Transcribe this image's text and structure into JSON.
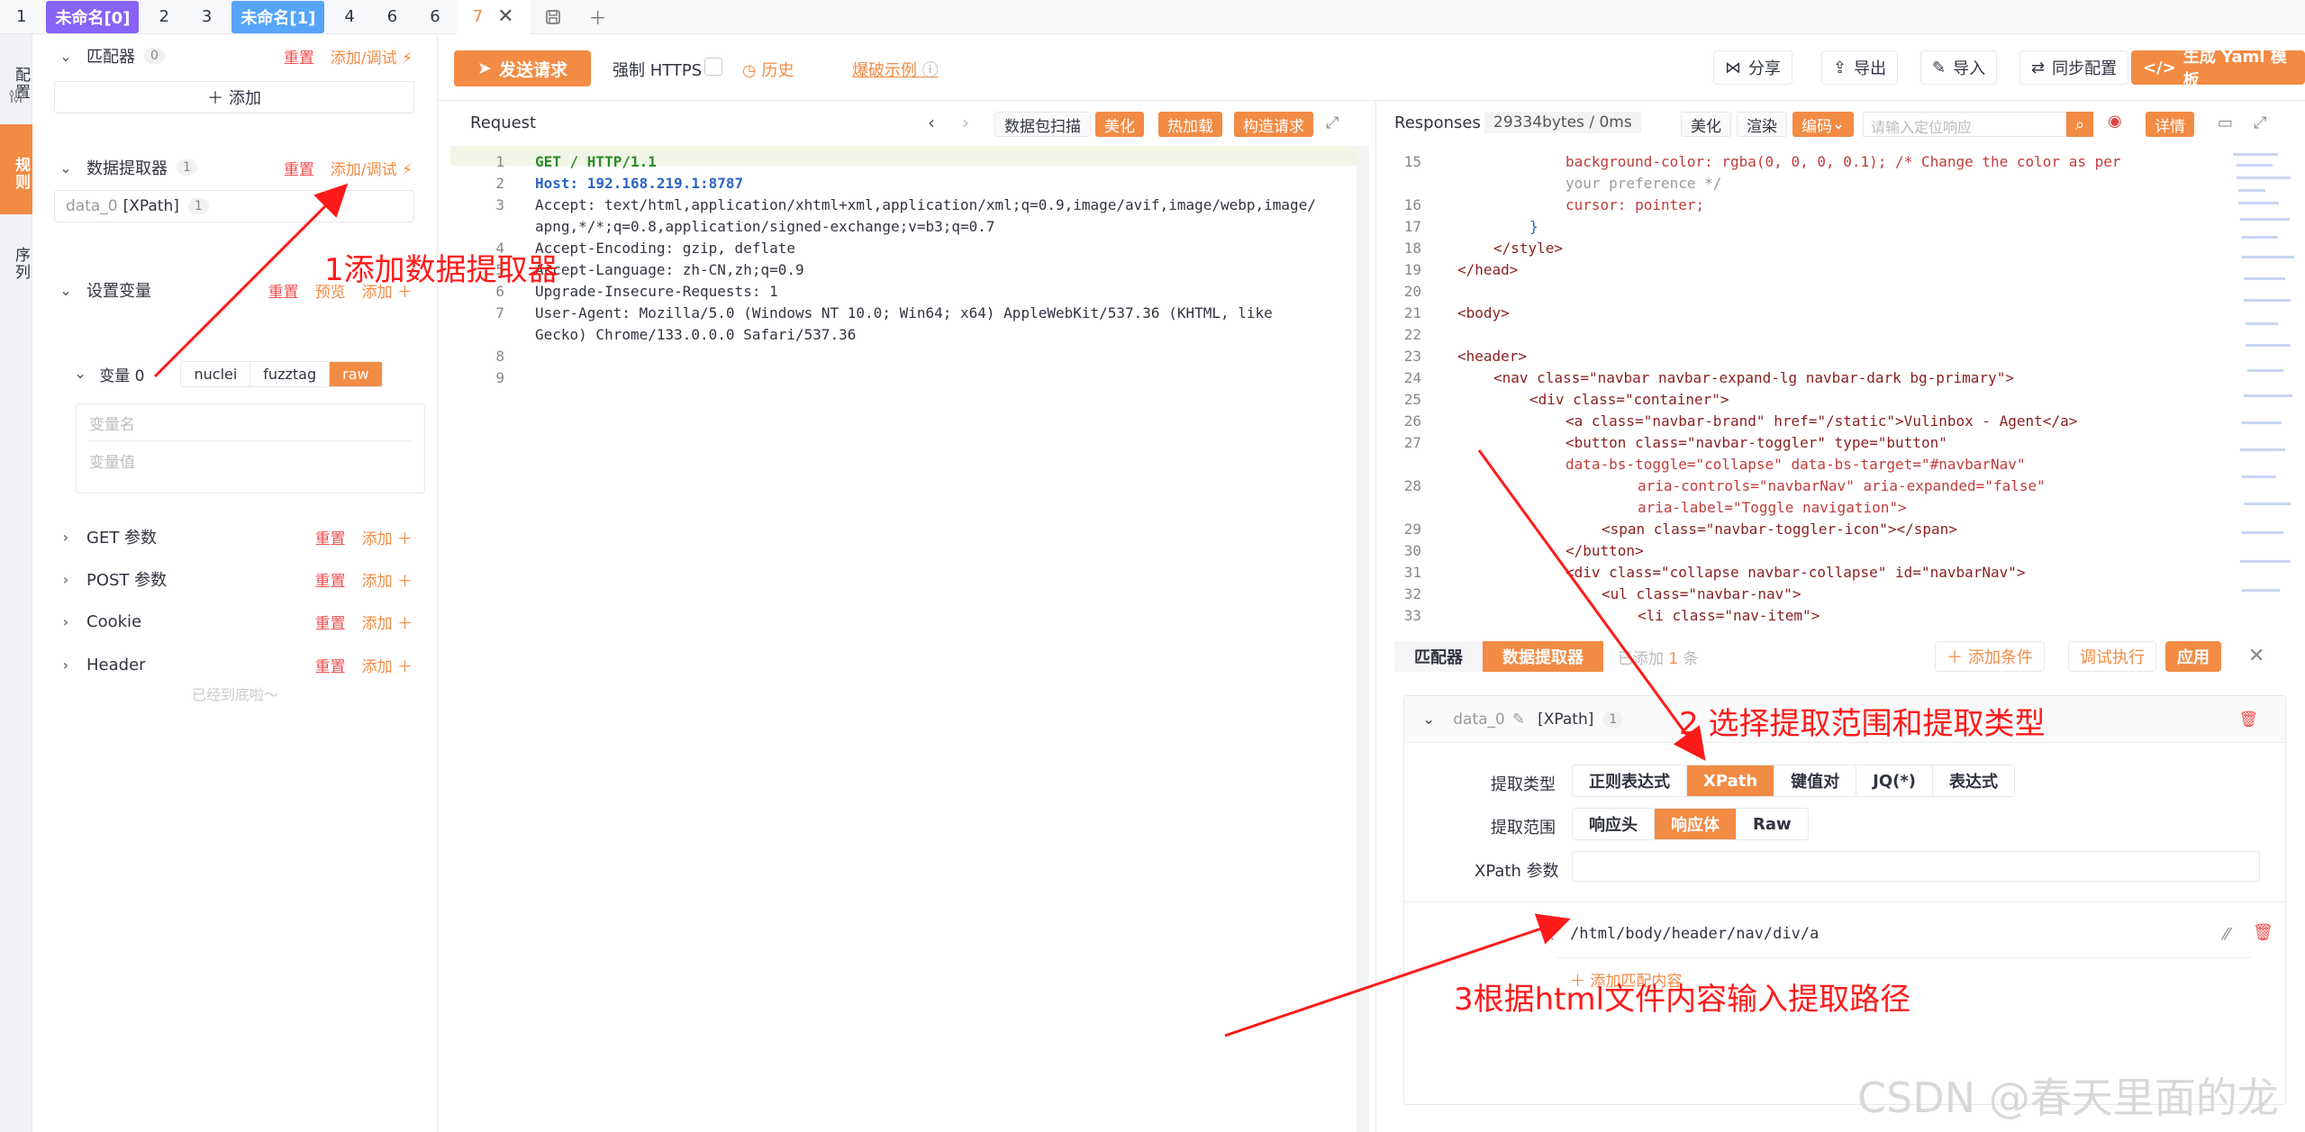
{
  "tabs": [
    {
      "label": "1"
    },
    {
      "label": "未命名[0]"
    },
    {
      "label": "2"
    },
    {
      "label": "3"
    },
    {
      "label": "未命名[1]"
    },
    {
      "label": "4"
    },
    {
      "label": "6"
    },
    {
      "label": "6"
    },
    {
      "label": "7"
    }
  ],
  "rail": {
    "config": "配置",
    "rules": "规则",
    "sequence": "序列"
  },
  "left": {
    "matcher": {
      "title": "匹配器",
      "count": "0",
      "reset": "重置",
      "add": "添加/调试",
      "add_btn": "添加"
    },
    "extractor": {
      "title": "数据提取器",
      "count": "1",
      "reset": "重置",
      "add": "添加/调试",
      "item_name": "data_0",
      "item_type": "[XPath]",
      "item_count": "1"
    },
    "vars": {
      "title": "设置变量",
      "reset": "重置",
      "preview": "预览",
      "add": "添加",
      "var_name": "变量 0",
      "modes": [
        "nuclei",
        "fuzztag",
        "raw"
      ],
      "ph_name": "变量名",
      "ph_value": "变量值"
    },
    "get": {
      "title": "GET 参数",
      "reset": "重置",
      "add": "添加"
    },
    "post": {
      "title": "POST 参数",
      "reset": "重置",
      "add": "添加"
    },
    "cookie": {
      "title": "Cookie",
      "reset": "重置",
      "add": "添加"
    },
    "header": {
      "title": "Header",
      "reset": "重置",
      "add": "添加"
    },
    "end": "已经到底啦～"
  },
  "toolbar": {
    "send": "发送请求",
    "force_https": "强制 HTTPS",
    "history": "历史",
    "blast_example": "爆破示例",
    "share": "分享",
    "export": "导出",
    "import": "导入",
    "sync": "同步配置",
    "gen_yaml": "生成 Yaml 模板"
  },
  "request": {
    "title": "Request",
    "scan": "数据包扫描",
    "beautify": "美化",
    "hotload": "热加载",
    "build": "构造请求",
    "lines": [
      {
        "n": "1",
        "t": "GET / HTTP/1.1"
      },
      {
        "n": "2",
        "t": "Host: 192.168.219.1:8787"
      },
      {
        "n": "3",
        "t": "Accept: text/html,application/xhtml+xml,application/xml;q=0.9,image/avif,image/webp,image/"
      },
      {
        "n": "",
        "t": "apng,*/*;q=0.8,application/signed-exchange;v=b3;q=0.7"
      },
      {
        "n": "4",
        "t": "Accept-Encoding: gzip, deflate"
      },
      {
        "n": "5",
        "t": "Accept-Language: zh-CN,zh;q=0.9"
      },
      {
        "n": "6",
        "t": "Upgrade-Insecure-Requests: 1"
      },
      {
        "n": "7",
        "t": "User-Agent: Mozilla/5.0 (Windows NT 10.0; Win64; x64) AppleWebKit/537.36 (KHTML, like"
      },
      {
        "n": "",
        "t": "Gecko) Chrome/133.0.0.0 Safari/537.36"
      },
      {
        "n": "8",
        "t": ""
      },
      {
        "n": "9",
        "t": ""
      }
    ]
  },
  "response": {
    "title": "Responses",
    "size": "29334bytes / 0ms",
    "beautify": "美化",
    "render": "渲染",
    "encoding": "编码",
    "search_ph": "请输入定位响应",
    "detail": "详情",
    "lines": [
      {
        "n": "15",
        "t": "background-color: rgba(0, 0, 0, 0.1); /* Change the color as per"
      },
      {
        "n": "",
        "t": "your preference */"
      },
      {
        "n": "16",
        "t": "cursor: pointer;"
      },
      {
        "n": "17",
        "t": "}"
      },
      {
        "n": "18",
        "t": "</style>"
      },
      {
        "n": "19",
        "t": "</head>"
      },
      {
        "n": "20",
        "t": ""
      },
      {
        "n": "21",
        "t": "<body>"
      },
      {
        "n": "22",
        "t": ""
      },
      {
        "n": "23",
        "t": "<header>"
      },
      {
        "n": "24",
        "t": "<nav class=\"navbar navbar-expand-lg navbar-dark bg-primary\">"
      },
      {
        "n": "25",
        "t": "<div class=\"container\">"
      },
      {
        "n": "26",
        "t": "<a class=\"navbar-brand\" href=\"/static\">Vulinbox - Agent</a>"
      },
      {
        "n": "27",
        "t": "<button class=\"navbar-toggler\" type=\"button\""
      },
      {
        "n": "",
        "t": "data-bs-toggle=\"collapse\" data-bs-target=\"#navbarNav\""
      },
      {
        "n": "28",
        "t": "aria-controls=\"navbarNav\" aria-expanded=\"false\""
      },
      {
        "n": "",
        "t": "aria-label=\"Toggle navigation\">"
      },
      {
        "n": "29",
        "t": "<span class=\"navbar-toggler-icon\"></span>"
      },
      {
        "n": "30",
        "t": "</button>"
      },
      {
        "n": "31",
        "t": "<div class=\"collapse navbar-collapse\" id=\"navbarNav\">"
      },
      {
        "n": "32",
        "t": "<ul class=\"navbar-nav\">"
      },
      {
        "n": "33",
        "t": "<li class=\"nav-item\">"
      }
    ]
  },
  "extractor": {
    "tab_matcher": "匹配器",
    "tab_extractor": "数据提取器",
    "added": "已添加",
    "added_count": "1",
    "added_unit": "条",
    "add_condition": "添加条件",
    "debug_run": "调试执行",
    "apply": "应用",
    "item_name": "data_0",
    "item_type": "[XPath]",
    "item_count": "1",
    "type_label": "提取类型",
    "types": [
      "正则表达式",
      "XPath",
      "键值对",
      "JQ(*)",
      "表达式"
    ],
    "scope_label": "提取范围",
    "scopes": [
      "响应头",
      "响应体",
      "Raw"
    ],
    "xpath_param": "XPath 参数",
    "xpath_value": "/html/body/header/nav/div/a",
    "add_match": "添加匹配内容"
  },
  "annotations": {
    "a1": "1添加数据提取器",
    "a2": "2 选择提取范围和提取类型",
    "a3": "3根据html文件内容输入提取路径"
  },
  "watermark": "CSDN @春天里面的龙"
}
